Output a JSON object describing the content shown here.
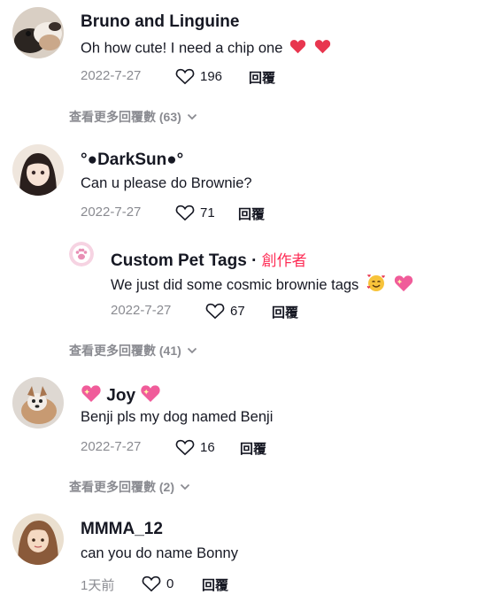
{
  "colors": {
    "text": "#161823",
    "secondary": "#8a8b91",
    "creator": "#fe2c55",
    "heart": "#e8364f"
  },
  "comments": [
    {
      "username": "Bruno and Linguine",
      "text": "Oh how cute! I need a chip one",
      "date": "2022-7-27",
      "likes": "196",
      "reply_label": "回覆",
      "more_replies": "查看更多回覆數 (63)"
    },
    {
      "username": "°●DarkSun●°",
      "text": "Can u please do Brownie?",
      "date": "2022-7-27",
      "likes": "71",
      "reply_label": "回覆",
      "reply": {
        "username": "Custom Pet Tags",
        "separator": "·",
        "creator_label": "創作者",
        "text": "We just did some cosmic brownie tags",
        "date": "2022-7-27",
        "likes": "67",
        "reply_label": "回覆"
      },
      "more_replies": "查看更多回覆數 (41)"
    },
    {
      "username": "Joy",
      "text": "Benji pls my dog named Benji",
      "date": "2022-7-27",
      "likes": "16",
      "reply_label": "回覆",
      "more_replies": "查看更多回覆數 (2)"
    },
    {
      "username": "MMMA_12",
      "text": "can you do name Bonny",
      "date": "1天前",
      "likes": "0",
      "reply_label": "回覆"
    }
  ]
}
